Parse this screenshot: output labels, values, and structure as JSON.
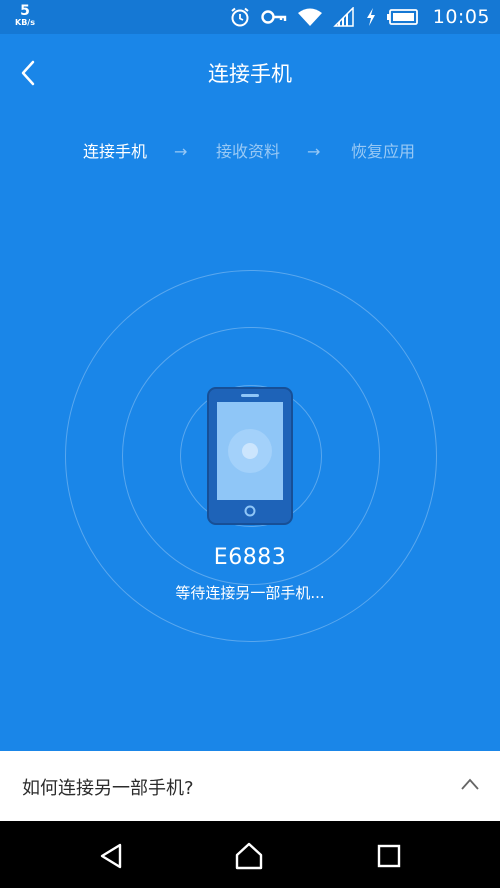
{
  "status_bar": {
    "speed_value": "5",
    "speed_unit": "KB/s",
    "time": "10:05",
    "icons": [
      "alarm-icon",
      "key-icon",
      "wifi-icon",
      "signal-icon",
      "charging-icon",
      "battery-icon"
    ]
  },
  "header": {
    "title": "连接手机",
    "back_icon": "back-arrow-icon"
  },
  "steps": [
    {
      "label": "连接手机",
      "state": "active"
    },
    {
      "label": "接收资料",
      "state": "inactive"
    },
    {
      "label": "恢复应用",
      "state": "inactive"
    }
  ],
  "step_arrow": "→",
  "device": {
    "code": "E6883",
    "status": "等待连接另一部手机..."
  },
  "help": {
    "label": "如何连接另一部手机?",
    "icon": "chevron-up-icon"
  },
  "nav": [
    "back-triangle-icon",
    "home-icon",
    "recents-icon"
  ],
  "colors": {
    "background": "#1a86e8",
    "status_bar": "#1578d4",
    "phone_body": "#1e63b8",
    "phone_screen": "#8fc6f7",
    "help_panel": "#ffffff",
    "nav_bar": "#000000"
  }
}
